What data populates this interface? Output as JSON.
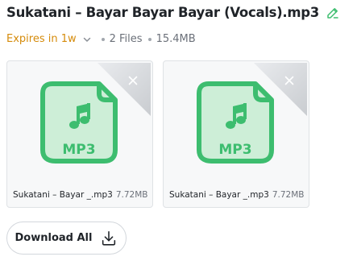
{
  "header": {
    "title": "Sukatani – Bayar Bayar Bayar (Vocals).mp3",
    "edit_icon": "pencil-icon"
  },
  "meta": {
    "expires": "Expires in 1w",
    "files": "2 Files",
    "size": "15.4MB"
  },
  "colors": {
    "accent_green": "#3dbd6f",
    "expires_orange": "#d58b0b"
  },
  "files": [
    {
      "badge": "MP3",
      "name": "Sukatani – Bayar _.mp3",
      "size": "7.72MB",
      "icon": "audio-file-icon"
    },
    {
      "badge": "MP3",
      "name": "Sukatani – Bayar _.mp3",
      "size": "7.72MB",
      "icon": "audio-file-icon"
    }
  ],
  "actions": {
    "download_all": "Download All"
  }
}
